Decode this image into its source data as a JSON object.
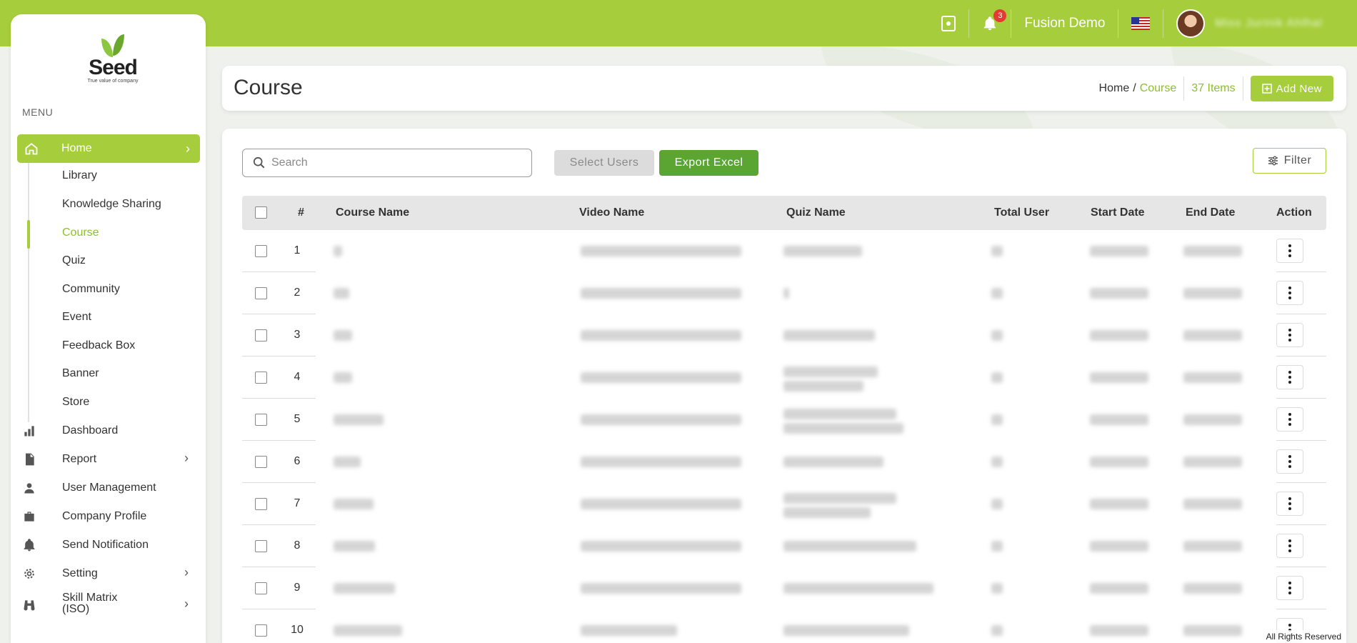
{
  "topbar": {
    "notification_count": "3",
    "company_name": "Fusion Demo",
    "username": "Miss Jurinik Ahlhal",
    "colors": {
      "bar": "#a6cd3b",
      "badge": "#e53935"
    }
  },
  "sidebar": {
    "logo": {
      "name": "Seed",
      "tagline": "True value of company"
    },
    "menu_label": "MENU",
    "home": {
      "label": "Home"
    },
    "sub_items": [
      {
        "label": "Library"
      },
      {
        "label": "Knowledge Sharing"
      },
      {
        "label": "Course"
      },
      {
        "label": "Quiz"
      },
      {
        "label": "Community"
      },
      {
        "label": "Event"
      },
      {
        "label": "Feedback Box"
      },
      {
        "label": "Banner"
      },
      {
        "label": "Store"
      }
    ],
    "items": [
      {
        "label": "Dashboard",
        "icon": "bar-chart-icon"
      },
      {
        "label": "Report",
        "icon": "document-icon"
      },
      {
        "label": "User Management",
        "icon": "user-icon"
      },
      {
        "label": "Company Profile",
        "icon": "briefcase-icon"
      },
      {
        "label": "Send Notification",
        "icon": "bell-icon"
      },
      {
        "label": "Setting",
        "icon": "gear-icon"
      },
      {
        "label": "Skill Matrix\n(ISO)",
        "icon": "binoculars-icon"
      }
    ]
  },
  "header": {
    "title": "Course",
    "breadcrumb_home": "Home",
    "breadcrumb_sep": "/",
    "breadcrumb_current": "Course",
    "items_count": "37 Items",
    "add_new_label": "Add New"
  },
  "toolbar": {
    "search_placeholder": "Search",
    "select_users_label": "Select Users",
    "export_label": "Export Excel",
    "filter_label": "Filter"
  },
  "table": {
    "columns": [
      "#",
      "Course Name",
      "Video Name",
      "Quiz Name",
      "Total User",
      "Start Date",
      "End Date",
      "Action"
    ],
    "rows": [
      {
        "num": "1"
      },
      {
        "num": "2"
      },
      {
        "num": "3"
      },
      {
        "num": "4"
      },
      {
        "num": "5"
      },
      {
        "num": "6"
      },
      {
        "num": "7"
      },
      {
        "num": "8"
      },
      {
        "num": "9"
      },
      {
        "num": "10"
      }
    ]
  },
  "footer": {
    "text": "All Rights Reserved"
  }
}
